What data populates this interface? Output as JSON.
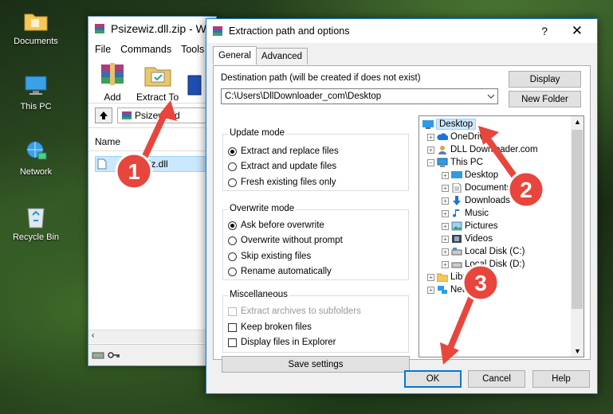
{
  "desktop": {
    "icons": [
      {
        "label": "Documents",
        "icon": "folder-icon"
      },
      {
        "label": "This PC",
        "icon": "computer-icon"
      },
      {
        "label": "Network",
        "icon": "network-icon"
      },
      {
        "label": "Recycle Bin",
        "icon": "recycle-bin-icon"
      }
    ]
  },
  "winrar": {
    "title": "Psizewiz.dll.zip - Wi",
    "menu": [
      "File",
      "Commands",
      "Tools"
    ],
    "toolbar": {
      "add": "Add",
      "extract_to": "Extract To"
    },
    "address": "Psizewiz.d",
    "column_name": "Name",
    "file": "psizewiz.dll"
  },
  "dialog": {
    "title": "Extraction path and options",
    "help_glyph": "?",
    "close_glyph": "✕",
    "tabs": [
      "General",
      "Advanced"
    ],
    "dest_label": "Destination path (will be created if does not exist)",
    "dest_value": "C:\\Users\\DllDownloader_com\\Desktop",
    "display_btn": "Display",
    "new_folder_btn": "New Folder",
    "update_mode": {
      "title": "Update mode",
      "options": [
        "Extract and replace files",
        "Extract and update files",
        "Fresh existing files only"
      ],
      "selected": 0
    },
    "overwrite_mode": {
      "title": "Overwrite mode",
      "options": [
        "Ask before overwrite",
        "Overwrite without prompt",
        "Skip existing files",
        "Rename automatically"
      ],
      "selected": 0
    },
    "misc": {
      "title": "Miscellaneous",
      "options": [
        "Extract archives to subfolders",
        "Keep broken files",
        "Display files in Explorer"
      ]
    },
    "save_btn": "Save settings",
    "tree": {
      "desktop": "Desktop",
      "onedrive": "OneDrive",
      "dlldownloader": "DLL Downloader.com",
      "thispc": "This PC",
      "pc_items": [
        "Desktop",
        "Documents",
        "Downloads",
        "Music",
        "Pictures",
        "Videos",
        "Local Disk (C:)",
        "Local Disk (D:)"
      ],
      "libraries": "Libraries",
      "network": "Network"
    },
    "ok_btn": "OK",
    "cancel_btn": "Cancel",
    "help_btn": "Help"
  },
  "annotations": {
    "step1": "1",
    "step2": "2",
    "step3": "3",
    "marker_color": "#e8453c"
  }
}
